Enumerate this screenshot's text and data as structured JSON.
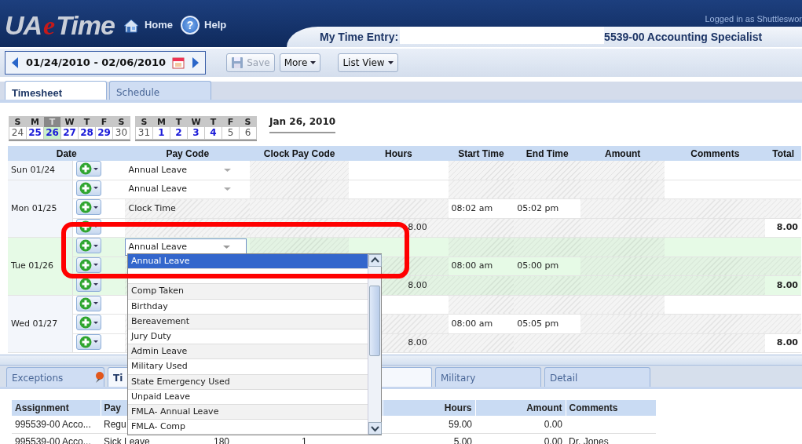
{
  "header": {
    "logo": {
      "prefix": "UA",
      "accent": "e",
      "suffix": "Time"
    },
    "links": [
      {
        "label": "Home",
        "kind": "home"
      },
      {
        "label": "Help",
        "kind": "help",
        "glyph": "?"
      }
    ],
    "logged_in": "Logged in as Shuttleswor",
    "entry_label": "My Time Entry:",
    "assignment": "5539-00 Accounting Specialist"
  },
  "toolbar": {
    "date_range": "01/24/2010 - 02/06/2010",
    "buttons": [
      {
        "label": "Save",
        "kind": "save",
        "disabled": true
      },
      {
        "label": "More",
        "kind": "menu",
        "disabled": false
      },
      {
        "label": "List View",
        "kind": "menu",
        "disabled": false
      }
    ]
  },
  "tabs": [
    {
      "label": "Timesheet",
      "selected": true
    },
    {
      "label": "Schedule",
      "selected": false
    }
  ],
  "calendar": {
    "weeks": [
      {
        "days": [
          {
            "dow": "S",
            "date": "24",
            "workday": false,
            "selected": false
          },
          {
            "dow": "M",
            "date": "25",
            "workday": true,
            "selected": false
          },
          {
            "dow": "T",
            "date": "26",
            "workday": true,
            "selected": true
          },
          {
            "dow": "W",
            "date": "27",
            "workday": true,
            "selected": false
          },
          {
            "dow": "T",
            "date": "28",
            "workday": true,
            "selected": false
          },
          {
            "dow": "F",
            "date": "29",
            "workday": true,
            "selected": false
          },
          {
            "dow": "S",
            "date": "30",
            "workday": false,
            "selected": false
          }
        ]
      },
      {
        "days": [
          {
            "dow": "S",
            "date": "31",
            "workday": false,
            "selected": false
          },
          {
            "dow": "M",
            "date": "1",
            "workday": true,
            "selected": false
          },
          {
            "dow": "T",
            "date": "2",
            "workday": true,
            "selected": false
          },
          {
            "dow": "W",
            "date": "3",
            "workday": true,
            "selected": false
          },
          {
            "dow": "T",
            "date": "4",
            "workday": true,
            "selected": false
          },
          {
            "dow": "F",
            "date": "5",
            "workday": false,
            "selected": false
          },
          {
            "dow": "S",
            "date": "6",
            "workday": false,
            "selected": false
          }
        ]
      }
    ],
    "current_date": "Jan 26, 2010"
  },
  "grid": {
    "columns": [
      "Date",
      "Pay Code",
      "Clock Pay Code",
      "Hours",
      "Start Time",
      "End Time",
      "Amount",
      "Comments",
      "Total"
    ],
    "days": [
      {
        "date": "Sun 01/24",
        "selected": false,
        "entries": [
          {
            "kind": "leave",
            "pay_code": "Annual Leave"
          }
        ]
      },
      {
        "date": "Mon 01/25",
        "selected": false,
        "entries": [
          {
            "kind": "leave",
            "pay_code": "Annual Leave"
          },
          {
            "kind": "clock",
            "pay_code": "Clock Time",
            "start_time": "08:02 am",
            "end_time": "05:02 pm"
          },
          {
            "kind": "summary",
            "hours": "8.00",
            "total": "8.00"
          }
        ]
      },
      {
        "date": "Tue 01/26",
        "selected": true,
        "entries": [
          {
            "kind": "editing",
            "pay_code": "Annual Leave"
          },
          {
            "kind": "clock",
            "start_time": "08:00 am",
            "end_time": "05:00 pm"
          },
          {
            "kind": "summary",
            "hours": "8.00",
            "total": "8.00"
          }
        ]
      },
      {
        "date": "Wed 01/27",
        "selected": false,
        "entries": [
          {
            "kind": "leave"
          },
          {
            "kind": "clock",
            "start_time": "08:00 am",
            "end_time": "05:05 pm"
          },
          {
            "kind": "summary",
            "hours": "8.00",
            "total": "8.00"
          }
        ]
      }
    ]
  },
  "dropdown": {
    "items": [
      {
        "kind": "option",
        "label": "Annual Leave",
        "selected": true
      },
      {
        "kind": "obscured",
        "selected": false
      },
      {
        "kind": "option",
        "label": "Comp Taken",
        "selected": false
      },
      {
        "kind": "option",
        "label": "Birthday",
        "selected": false
      },
      {
        "kind": "option",
        "label": "Bereavement",
        "selected": false
      },
      {
        "kind": "option",
        "label": "Jury Duty",
        "selected": false
      },
      {
        "kind": "option",
        "label": "Admin Leave",
        "selected": false
      },
      {
        "kind": "option",
        "label": "Military Used",
        "selected": false
      },
      {
        "kind": "option",
        "label": "State Emergency Used",
        "selected": false
      },
      {
        "kind": "option",
        "label": "Unpaid Leave",
        "selected": false
      },
      {
        "kind": "option",
        "label": "FMLA- Annual Leave",
        "selected": false
      },
      {
        "kind": "option",
        "label": "FMLA- Comp",
        "selected": false
      }
    ]
  },
  "bottom": {
    "tabs": [
      {
        "label": "Exceptions",
        "kind": "pinned",
        "selected": false
      },
      {
        "label": "Ti",
        "selected": true
      },
      {
        "label": "Military",
        "selected": false
      },
      {
        "label": "Detail",
        "selected": false
      }
    ],
    "table": {
      "columns": {
        "assignment": "Assignment",
        "pay_code": "Pay",
        "hours": "Hours",
        "amount": "Amount",
        "comments": "Comments"
      },
      "rows": [
        {
          "assignment": "995539-00 Acco...",
          "pay_code": "Regu",
          "hours": "59.00",
          "amount": "0.00"
        },
        {
          "assignment": "995539-00 Acco...",
          "pay_code": "Sick Leave",
          "column_3": "180",
          "column_4": "1",
          "hours": "5.00",
          "amount": "0.00",
          "comments": "Dr. Jones"
        }
      ]
    }
  }
}
